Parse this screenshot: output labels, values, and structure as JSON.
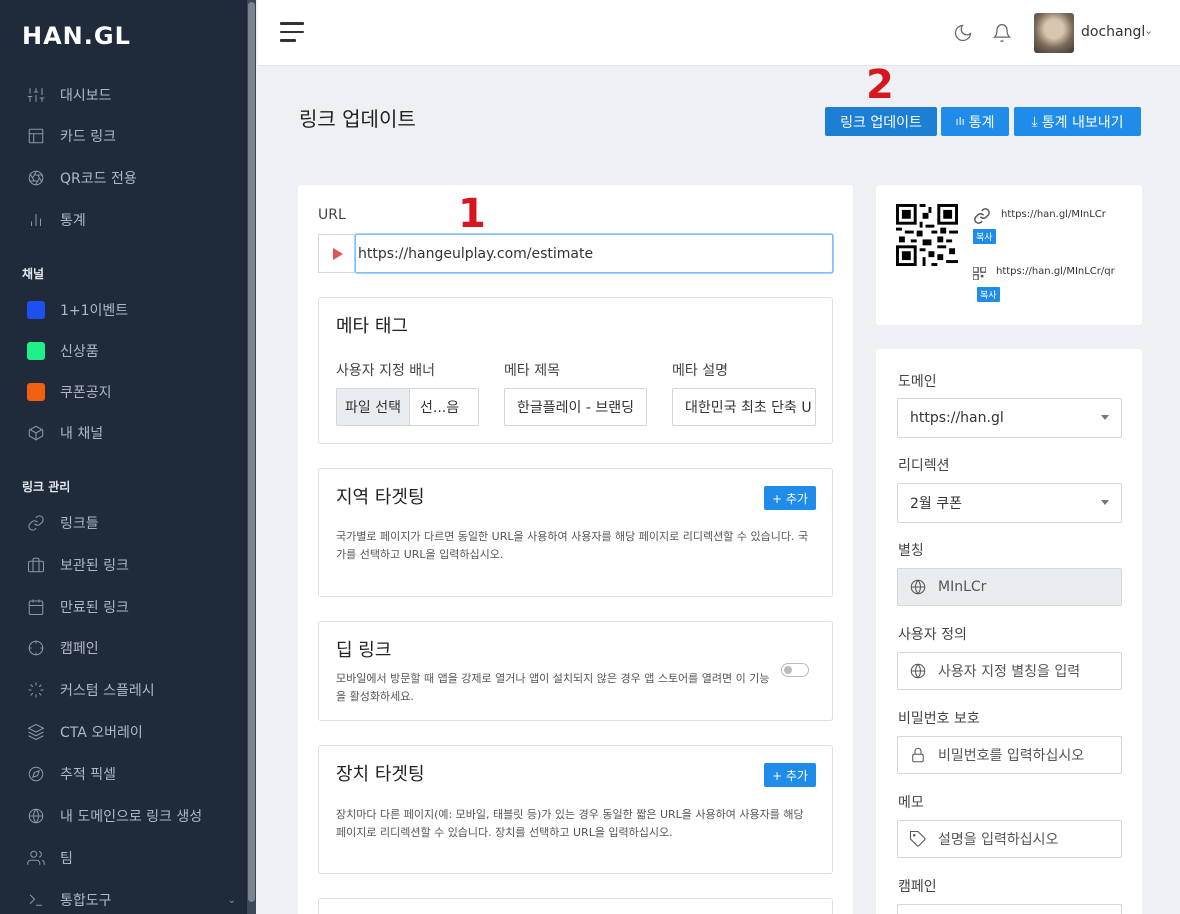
{
  "sidebar": {
    "logo": "HAN.GL",
    "items_top": [
      {
        "label": "대시보드",
        "icon": "sliders-icon"
      },
      {
        "label": "카드 링크",
        "icon": "layout-icon"
      },
      {
        "label": "QR코드 전용",
        "icon": "aperture-icon"
      },
      {
        "label": "통계",
        "icon": "bar-chart-icon"
      }
    ],
    "channels_title": "채널",
    "channels": [
      {
        "label": "1+1이벤트",
        "color": "#1e4ff0"
      },
      {
        "label": "신상품",
        "color": "#1ef08a"
      },
      {
        "label": "쿠폰공지",
        "color": "#f0600f"
      },
      {
        "label": "내 채널",
        "icon": "box-icon"
      }
    ],
    "links_title": "링크 관리",
    "links": [
      {
        "label": "링크들",
        "icon": "link-icon"
      },
      {
        "label": "보관된 링크",
        "icon": "briefcase-icon"
      },
      {
        "label": "만료된 링크",
        "icon": "calendar-icon"
      },
      {
        "label": "캠페인",
        "icon": "crosshair-icon"
      },
      {
        "label": "커스텀 스플레시",
        "icon": "loader-icon"
      },
      {
        "label": "CTA 오버레이",
        "icon": "layers-icon"
      },
      {
        "label": "추적 픽셀",
        "icon": "compass-icon"
      },
      {
        "label": "내 도메인으로 링크 생성",
        "icon": "globe-icon"
      },
      {
        "label": "팀",
        "icon": "users-icon"
      },
      {
        "label": "통합도구",
        "icon": "terminal-icon"
      }
    ]
  },
  "topbar": {
    "username": "dochangl"
  },
  "page": {
    "title": "링크 업데이트",
    "buttons": {
      "update": "링크 업데이트",
      "stats": "통계",
      "export": "통계 내보내기"
    },
    "annotations": [
      "1",
      "2"
    ]
  },
  "form": {
    "url_label": "URL",
    "url_value": "https://hangeulplay.com/estimate",
    "meta": {
      "title": "메타 태그",
      "banner_label": "사용자 지정 배너",
      "banner_file_button": "파일 선택",
      "banner_file_text": "선...음",
      "meta_title_label": "메타 제목",
      "meta_title_value": "한글플레이 - 브랜딩",
      "meta_desc_label": "메타 설명",
      "meta_desc_value": "대한민국 최초 단축 U"
    },
    "geo": {
      "title": "지역 타겟팅",
      "add": "+ 추가",
      "desc": "국가별로 페이지가 다르면 동일한 URL을 사용하여 사용자를 해당 페이지로 리디렉션할 수 있습니다. 국가를 선택하고 URL을 입력하십시오."
    },
    "deeplink": {
      "title": "딥 링크",
      "desc": "모바일에서 방문할 때 앱을 강제로 열거나 앱이 설치되지 않은 경우 앱 스토어를 열려면 이 기능을 활성화하세요."
    },
    "device": {
      "title": "장치 타겟팅",
      "add": "+ 추가",
      "desc": "장치마다 다른 페이지(예: 모바일, 태블릿 등)가 있는 경우 동일한 짧은 URL을 사용하여 사용자를 해당 페이지로 리디렉션할 수 있습니다. 장치를 선택하고 URL을 입력하십시오."
    }
  },
  "side": {
    "short_url": "https://han.gl/MInLCr",
    "qr_url": "https://han.gl/MInLCr/qr",
    "copy": "복사",
    "domain_label": "도메인",
    "domain_value": "https://han.gl",
    "redirect_label": "리디렉션",
    "redirect_value": "2월 쿠폰",
    "alias_label": "별칭",
    "alias_value": "MInLCr",
    "custom_label": "사용자 정의",
    "custom_placeholder": "사용자 지정 별칭을 입력",
    "password_label": "비밀번호 보호",
    "password_placeholder": "비밀번호를 입력하십시오",
    "memo_label": "메모",
    "memo_placeholder": "설명을 입력하십시오",
    "campaign_label": "캠페인"
  }
}
